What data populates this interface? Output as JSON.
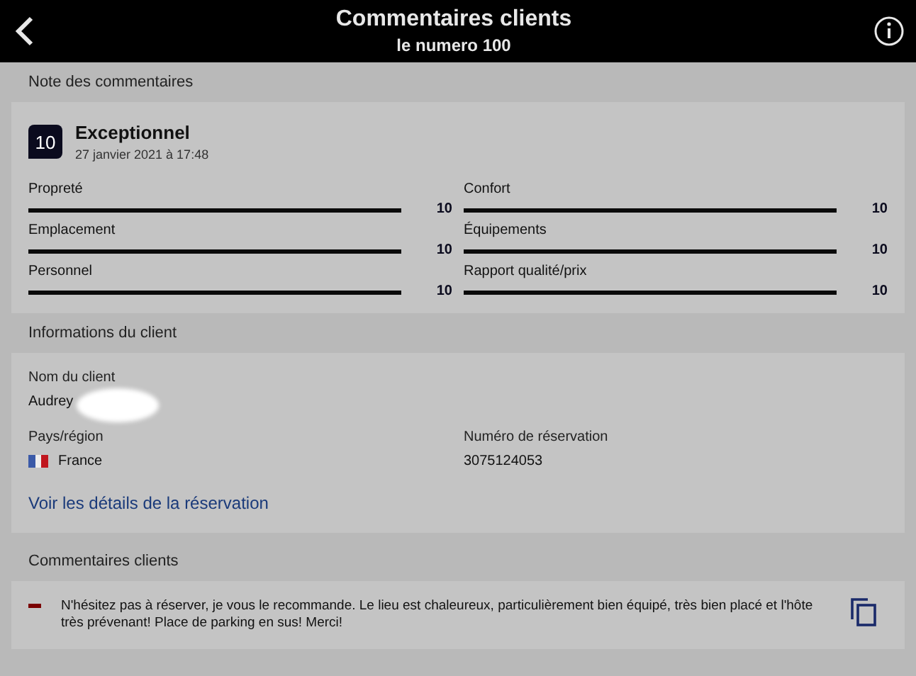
{
  "header": {
    "title": "Commentaires clients",
    "subtitle": "le numero 100"
  },
  "rating": {
    "section_title": "Note des commentaires",
    "score": "10",
    "label": "Exceptionnel",
    "date": "27 janvier 2021 à 17:48",
    "categories": [
      {
        "name": "Propreté",
        "level": 1,
        "value": "10"
      },
      {
        "name": "Confort",
        "level": 1,
        "value": "10"
      },
      {
        "name": "Emplacement",
        "level": 1,
        "value": "10"
      },
      {
        "name": "Équipements",
        "level": 1,
        "value": "10"
      },
      {
        "name": "Personnel",
        "level": 1,
        "value": "10"
      },
      {
        "name": "Rapport qualité/prix",
        "level": 1,
        "value": "10"
      }
    ]
  },
  "client": {
    "section_title": "Informations du client",
    "name_label": "Nom du client",
    "name": "Audrey",
    "name_redacted": true,
    "country_label": "Pays/région",
    "country": "France",
    "reservation_label": "Numéro de réservation",
    "reservation": "3075124053",
    "link": "Voir les détails de la réservation"
  },
  "comments": {
    "section_title": "Commentaires clients",
    "items": [
      {
        "kind": "negative",
        "text": "N'hésitez pas à réserver, je vous le recommande. Le lieu est chaleureux, particulièrement bien équipé,  très bien placé et l'hôte très prévenant! Place de parking en sus! Merci!"
      }
    ]
  }
}
